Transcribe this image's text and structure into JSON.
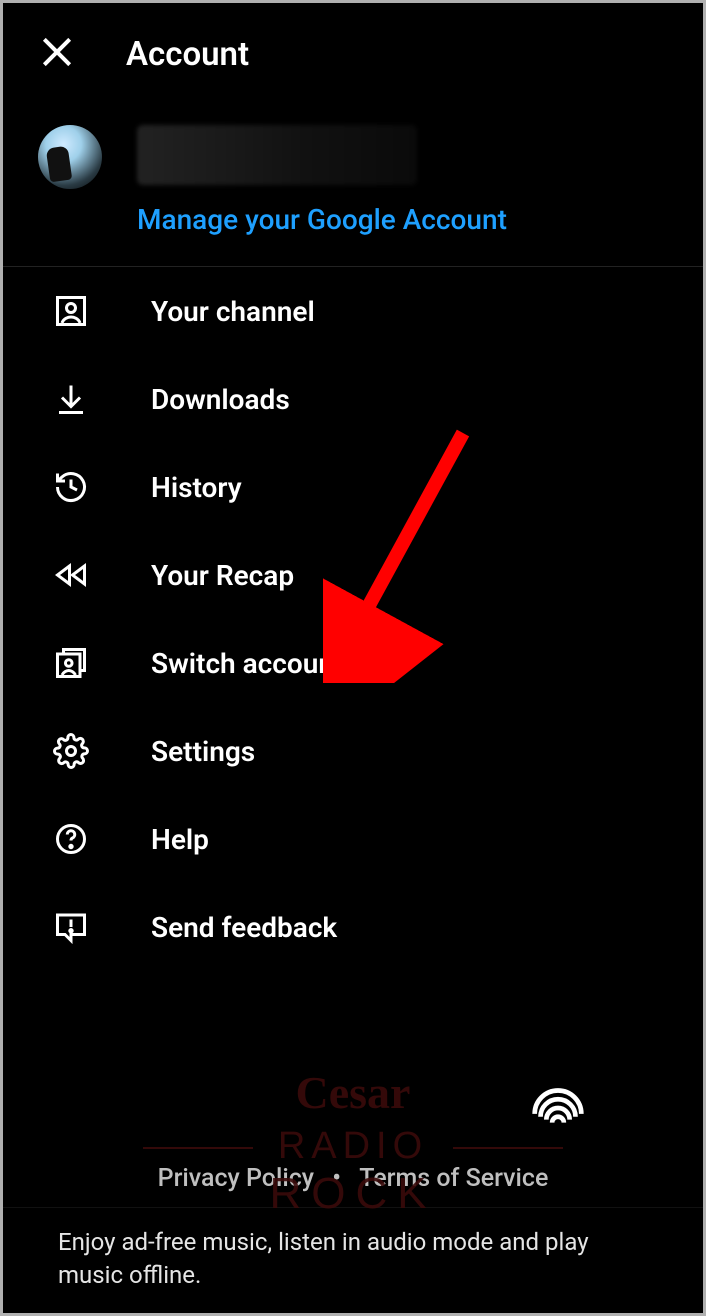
{
  "header": {
    "title": "Account"
  },
  "profile": {
    "manage_link": "Manage your Google Account"
  },
  "menu": {
    "items": [
      {
        "label": "Your channel"
      },
      {
        "label": "Downloads"
      },
      {
        "label": "History"
      },
      {
        "label": "Your Recap"
      },
      {
        "label": "Switch account"
      },
      {
        "label": "Settings"
      },
      {
        "label": "Help"
      },
      {
        "label": "Send feedback"
      }
    ]
  },
  "footer": {
    "privacy": "Privacy Policy",
    "terms": "Terms of Service",
    "banner": "Enjoy ad-free music, listen in audio mode and play music offline."
  },
  "annotation": {
    "arrow_color": "#ff0000"
  },
  "watermark": {
    "text_top": "Cesar",
    "text_mid": "RADIO",
    "text_bot": "ROCK",
    "color": "#3a0a0a"
  }
}
